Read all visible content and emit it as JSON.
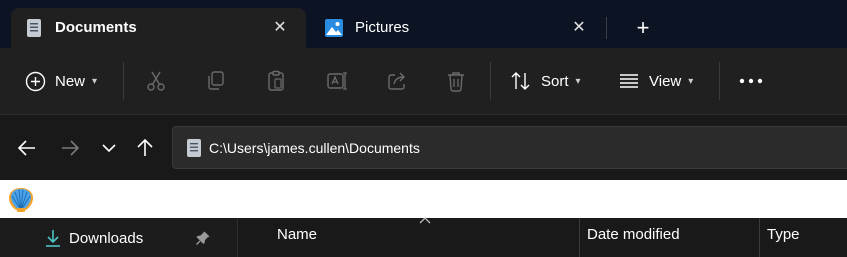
{
  "tabs": [
    {
      "label": "Documents",
      "active": true,
      "icon": "document-icon"
    },
    {
      "label": "Pictures",
      "active": false,
      "icon": "pictures-icon"
    }
  ],
  "new_tab_label": "+",
  "close_glyph": "✕",
  "toolbar": {
    "new_label": "New",
    "sort_label": "Sort",
    "view_label": "View",
    "more_glyph": "•••",
    "chevron_glyph": "⌄"
  },
  "address": {
    "path": "C:\\Users\\james.cullen\\Documents",
    "icon": "document-icon"
  },
  "sidebar": {
    "items": [
      {
        "label": "Downloads",
        "icon": "download-icon",
        "pinned": true
      }
    ]
  },
  "columns": [
    {
      "label": "Name"
    },
    {
      "label": "Date modified"
    },
    {
      "label": "Type"
    }
  ],
  "colors": {
    "titlebar_bg": "#0c1424",
    "toolbar_bg": "#202020",
    "content_bg": "#191919",
    "accent_download": "#4cc2c4"
  }
}
